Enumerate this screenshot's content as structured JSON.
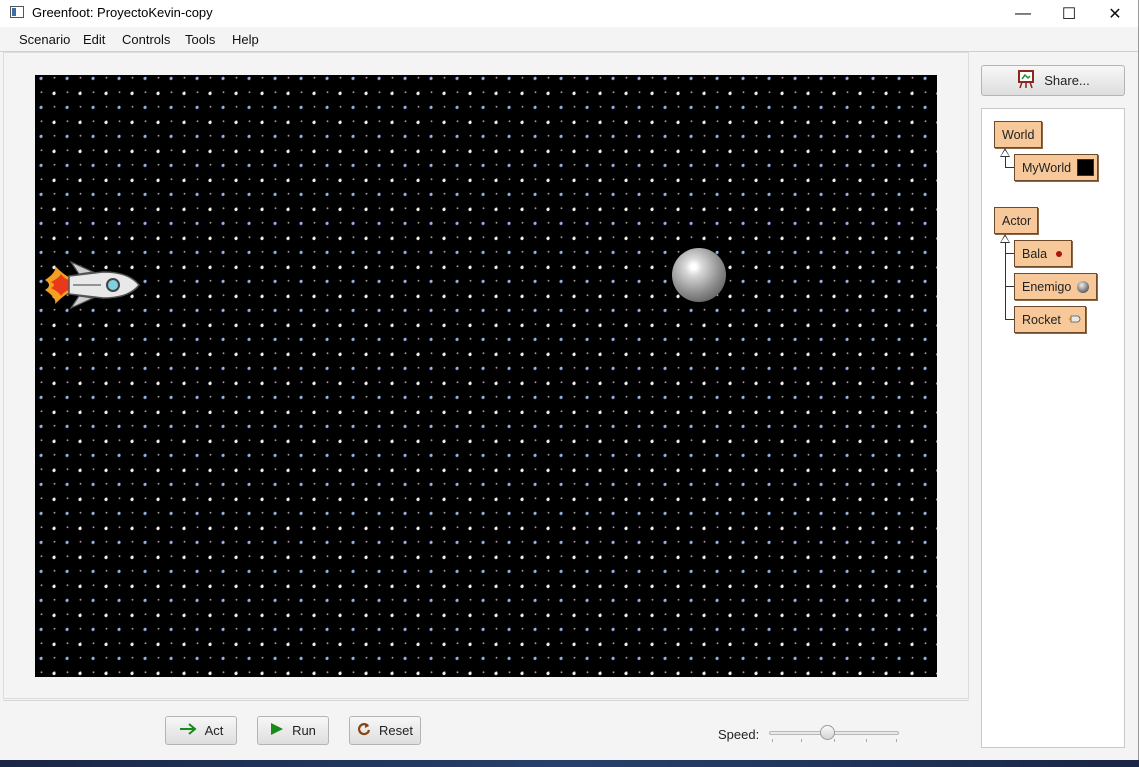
{
  "window": {
    "title": "Greenfoot: ProyectoKevin-copy",
    "controls": {
      "minimize": "—",
      "maximize": "☐",
      "close": "✕"
    }
  },
  "menu": [
    "Scenario",
    "Edit",
    "Controls",
    "Tools",
    "Help"
  ],
  "world": {
    "background": "starfield",
    "actors": [
      "rocket",
      "enemigo"
    ]
  },
  "controls": {
    "act_label": "Act",
    "run_label": "Run",
    "reset_label": "Reset",
    "speed_label": "Speed:",
    "speed_value": 0.45
  },
  "share": {
    "label": "Share..."
  },
  "classes": {
    "world_root": "World",
    "world_sub": [
      "MyWorld"
    ],
    "actor_root": "Actor",
    "actor_sub": [
      "Bala",
      "Enemigo",
      "Rocket"
    ]
  },
  "colors": {
    "class_box": "#f7c99a",
    "world_bg": "#000000",
    "run_green": "#1a8a1a",
    "reset_brown": "#8b4513"
  }
}
